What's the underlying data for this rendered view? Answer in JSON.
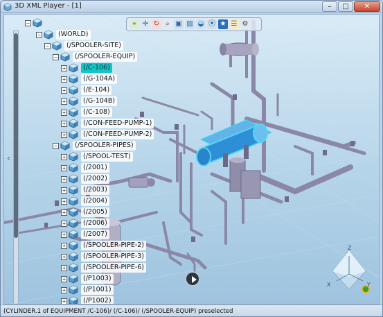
{
  "window": {
    "title": "3D XML Player - [1]",
    "controls": {
      "minimize": "–",
      "maximize": "□",
      "close": "✕"
    }
  },
  "toolbar": {
    "buttons": [
      {
        "name": "fit-all-icon",
        "glyph": "⌖",
        "color": "#3a7e2f"
      },
      {
        "name": "pan-icon",
        "glyph": "✛",
        "color": "#2f5d8f"
      },
      {
        "name": "rotate-icon",
        "glyph": "↻",
        "color": "#b13a2b"
      },
      {
        "name": "zoom-icon",
        "glyph": "⌕",
        "color": "#2f4f6f"
      },
      {
        "name": "normal-view-icon",
        "glyph": "▣",
        "color": "#35639a"
      },
      {
        "name": "view-selector-icon",
        "glyph": "▧",
        "color": "#2d6aa6"
      },
      {
        "name": "shading-icon",
        "glyph": "◒",
        "color": "#1e6fb0"
      },
      {
        "name": "hide-show-icon",
        "glyph": "⦿",
        "color": "#1f5c94"
      },
      {
        "name": "measure-icon",
        "glyph": "★",
        "color": "#ffffff"
      },
      {
        "name": "properties-icon",
        "glyph": "☰",
        "color": "#7a6a2a"
      },
      {
        "name": "settings-icon",
        "glyph": "⚙",
        "color": "#3d4b59"
      }
    ]
  },
  "tree": {
    "nodes": [
      {
        "label": "",
        "depth": 0,
        "expander": "−"
      },
      {
        "label": "(WORLD)",
        "depth": 1,
        "expander": "−"
      },
      {
        "label": "(/SPOOLER-SITE)",
        "depth": 2,
        "expander": "−"
      },
      {
        "label": "(/SPOOLER-EQUIP)",
        "depth": 3,
        "expander": "−"
      },
      {
        "label": "(/C-106)",
        "depth": 4,
        "expander": "+",
        "selected": true
      },
      {
        "label": "(/G-104A)",
        "depth": 4,
        "expander": "+"
      },
      {
        "label": "(/E-104)",
        "depth": 4,
        "expander": "+"
      },
      {
        "label": "(/G-104B)",
        "depth": 4,
        "expander": "+"
      },
      {
        "label": "(/C-108)",
        "depth": 4,
        "expander": "+"
      },
      {
        "label": "(/CON-FEED-PUMP-1)",
        "depth": 4,
        "expander": "+"
      },
      {
        "label": "(/CON-FEED-PUMP-2)",
        "depth": 4,
        "expander": "+"
      },
      {
        "label": "(/SPOOLER-PIPES)",
        "depth": 3,
        "expander": "−"
      },
      {
        "label": "(/SPOOL-TEST)",
        "depth": 4,
        "expander": "+"
      },
      {
        "label": "(/2001)",
        "depth": 4,
        "expander": "+"
      },
      {
        "label": "(/2002)",
        "depth": 4,
        "expander": "+"
      },
      {
        "label": "(/2003)",
        "depth": 4,
        "expander": "+"
      },
      {
        "label": "(/2004)",
        "depth": 4,
        "expander": "+"
      },
      {
        "label": "(/2005)",
        "depth": 4,
        "expander": "+"
      },
      {
        "label": "(/2006)",
        "depth": 4,
        "expander": "+"
      },
      {
        "label": "(/2007)",
        "depth": 4,
        "expander": "+"
      },
      {
        "label": "(/SPOOLER-PIPE-2)",
        "depth": 4,
        "expander": "+"
      },
      {
        "label": "(/SPOOLER-PIPE-3)",
        "depth": 4,
        "expander": "+"
      },
      {
        "label": "(/SPOOLER-PIPE-6)",
        "depth": 4,
        "expander": "+"
      },
      {
        "label": "(/P1003)",
        "depth": 4,
        "expander": "+"
      },
      {
        "label": "(/P1001)",
        "depth": 4,
        "expander": "+"
      },
      {
        "label": "(/P1002)",
        "depth": 4,
        "expander": "+"
      }
    ]
  },
  "compass": {
    "z": "Z",
    "x": "X",
    "y": "Y"
  },
  "status": {
    "text": "(CYLINDER.1 of EQUIPMENT /C-106)/ (/C-106)/ (/SPOOLER-EQUIP) preselected"
  },
  "colors": {
    "selection": "#16c4c6",
    "pipe": "#8a88a6",
    "highlight_vessel": "#2f8fd6"
  }
}
